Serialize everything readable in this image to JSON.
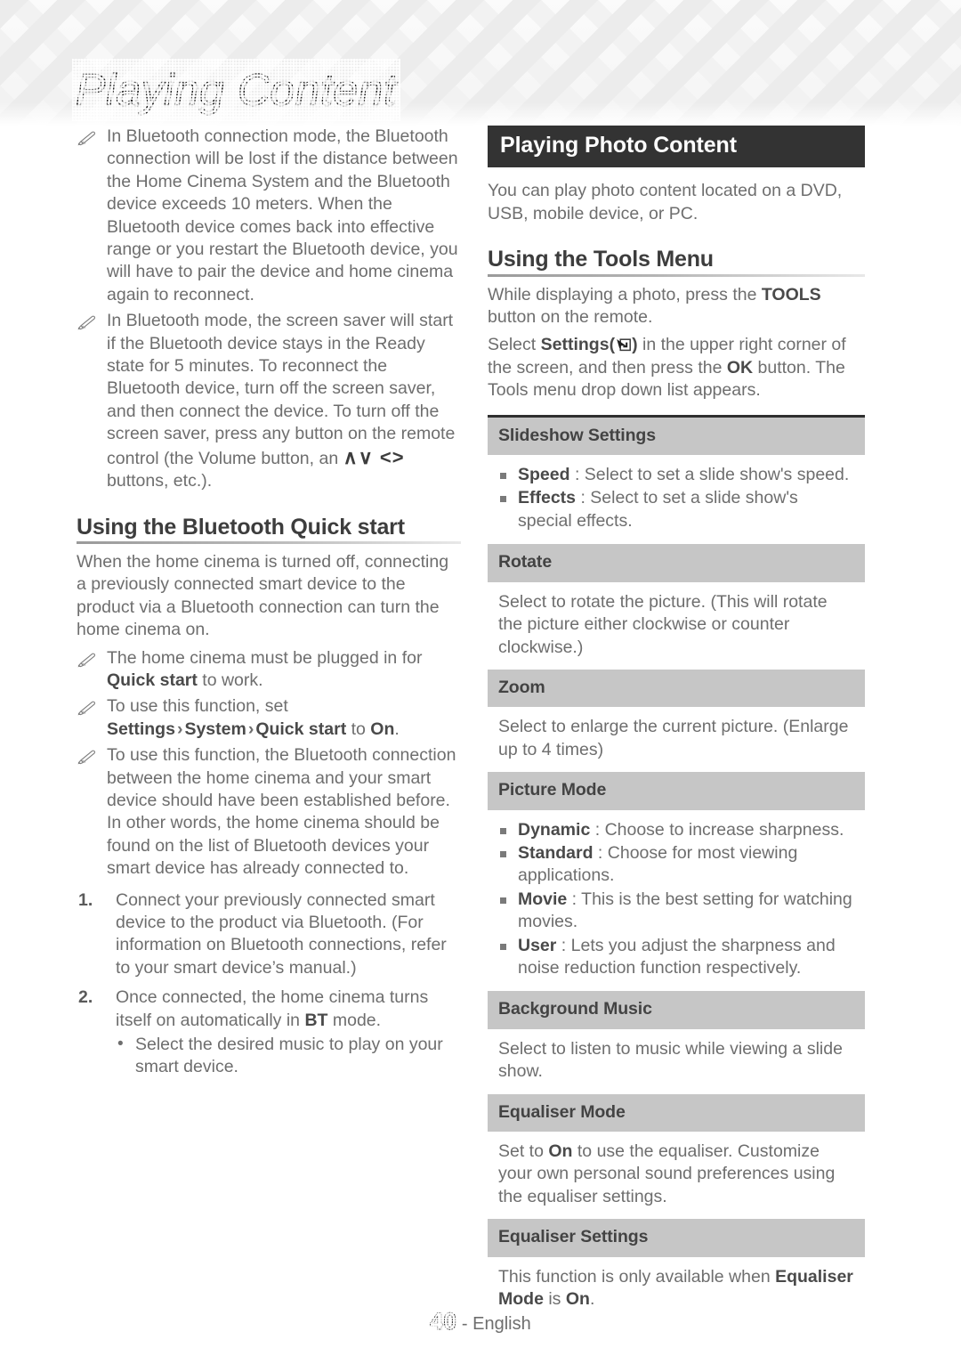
{
  "header": {
    "title": "Playing Content"
  },
  "left": {
    "notes_top": [
      {
        "icon": "pencil-note-icon",
        "text": "In Bluetooth connection mode, the Bluetooth connection will be lost if the distance between the Home Cinema System and the Bluetooth device exceeds 10 meters. When the Bluetooth device comes back into effective range or you restart the Bluetooth device, you will have to pair the device and home cinema again to reconnect."
      }
    ],
    "note_screensaver": {
      "icon": "pencil-note-icon",
      "part1": "In Bluetooth mode, the screen saver will start if the Bluetooth device stays in the Ready state for 5 minutes. To reconnect the Bluetooth device, turn off the screen saver, and then connect the device. To turn off the screen saver, press any button on the remote control (the Volume button, an ",
      "chevrons": "∧∨ <>",
      "part2": " buttons, etc.)."
    },
    "section_heading": "Using the Bluetooth Quick start",
    "section_intro": "When the home cinema is turned off, connecting a previously connected smart device to the product via a Bluetooth connection can turn the home cinema on.",
    "note_plugged": {
      "icon": "pencil-note-icon",
      "part1": "The home cinema must be plugged in for ",
      "bold1": "Quick start",
      "part2": " to work."
    },
    "note_settings": {
      "icon": "pencil-note-icon",
      "part1": "To use this function, set ",
      "bold1": "Settings",
      "sep1": "›",
      "bold2": "System",
      "sep2": "›",
      "bold3": "Quick start",
      "part2": " to ",
      "bold4": "On",
      "part3": "."
    },
    "note_established": {
      "icon": "pencil-note-icon",
      "text": "To use this function, the Bluetooth connection between the home cinema and your smart device should have been established before. In other words, the home cinema should be found on the list of Bluetooth devices your smart device has already connected to."
    },
    "steps": [
      {
        "num": "1.",
        "text": "Connect your previously connected smart device to the product via Bluetooth. (For information on Bluetooth connections, refer to your smart device’s manual.)"
      },
      {
        "num": "2.",
        "part1": "Once connected, the home cinema turns itself on automatically in ",
        "bold1": "BT",
        "part2": " mode.",
        "substeps": [
          "Select the desired music to play on your smart device."
        ]
      }
    ]
  },
  "right": {
    "banner_title": "Playing Photo Content",
    "intro": "You can play photo content located on a DVD, USB, mobile device, or PC.",
    "tools_heading": "Using the Tools Menu",
    "tools_para1_a": "While displaying a photo, press the ",
    "tools_para1_bold": "TOOLS",
    "tools_para1_b": " button on the remote.",
    "tools_para2_a": "Select ",
    "tools_para2_bold": "Settings",
    "tools_para2_icon": "settings-window-icon",
    "tools_para2_b": " in the upper right corner of the screen, and then press the ",
    "tools_para2_bold2": "OK",
    "tools_para2_c": " button. The Tools menu drop down list appears.",
    "table": [
      {
        "header": "Slideshow Settings",
        "bullets": [
          {
            "bold": "Speed",
            "sep": " : ",
            "text": "Select to set a slide show's speed."
          },
          {
            "bold": "Effects",
            "sep": " : ",
            "text": "Select to set a slide show's special effects."
          }
        ]
      },
      {
        "header": "Rotate",
        "text": "Select to rotate the picture. (This will rotate the picture either clockwise or counter clockwise.)"
      },
      {
        "header": "Zoom",
        "text": "Select to enlarge the current picture. (Enlarge up to 4 times)"
      },
      {
        "header": "Picture Mode",
        "bullets": [
          {
            "bold": "Dynamic",
            "sep": " : ",
            "text": "Choose to increase sharpness."
          },
          {
            "bold": "Standard",
            "sep": " : ",
            "text": "Choose for most viewing applications."
          },
          {
            "bold": "Movie",
            "sep": " : ",
            "text": "This is the best setting for watching movies."
          },
          {
            "bold": "User",
            "sep": " : ",
            "text": "Lets you adjust the sharpness and noise reduction function respectively."
          }
        ]
      },
      {
        "header": "Background Music",
        "text": "Select to listen to music while viewing a slide show."
      },
      {
        "header": "Equaliser Mode",
        "rich": {
          "a": "Set to ",
          "bold1": "On",
          "b": " to use the equaliser. Customize your own personal sound preferences using the equaliser settings."
        }
      },
      {
        "header": "Equaliser Settings",
        "rich2": {
          "a": "This function is only available when ",
          "bold1": "Equaliser Mode",
          "b": " is ",
          "bold2": "On",
          "c": "."
        }
      }
    ]
  },
  "footer": {
    "page_number": "40",
    "language": "- English"
  },
  "colors": {
    "banner_bg": "#333333",
    "table_header_bg": "#c6c6c6",
    "body_text": "#6e6e6e",
    "bold_text": "#4a4a4a"
  }
}
